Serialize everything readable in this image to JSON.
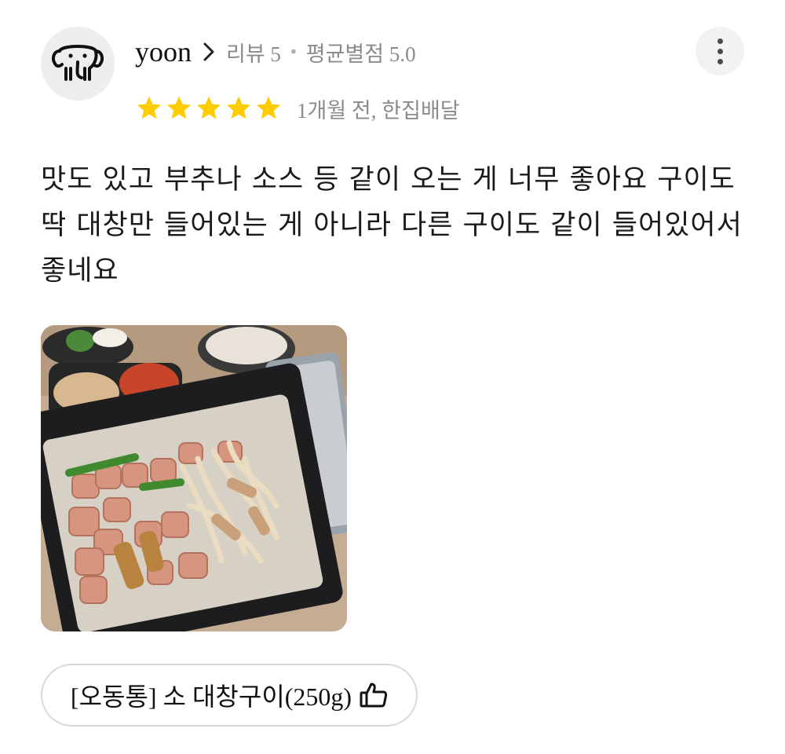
{
  "review": {
    "user_name": "yoon",
    "review_count": "리뷰 5",
    "separator": "•",
    "average_rating": "평균별점 5.0",
    "rating": 5,
    "rating_max": 5,
    "date_and_delivery": "1개월 전, 한집배달",
    "body": "맛도 있고 부추나 소스 등 같이 오는 게 너무 좋아요 구이도 딱 대창만 들어있는 게 아니라 다른 구이도 같이 들어있어서 좋네요",
    "ordered_menu": "[오동통] 소 대창구이(250g)"
  },
  "colors": {
    "star": "#ffcc00",
    "meta_text": "#8b8b8b",
    "chip_border": "#d8d8d8"
  },
  "icons": {
    "avatar": "elephant-icon",
    "more": "more-vertical-icon",
    "chevron": "chevron-right-icon",
    "menu_like": "thumbs-up-icon"
  }
}
